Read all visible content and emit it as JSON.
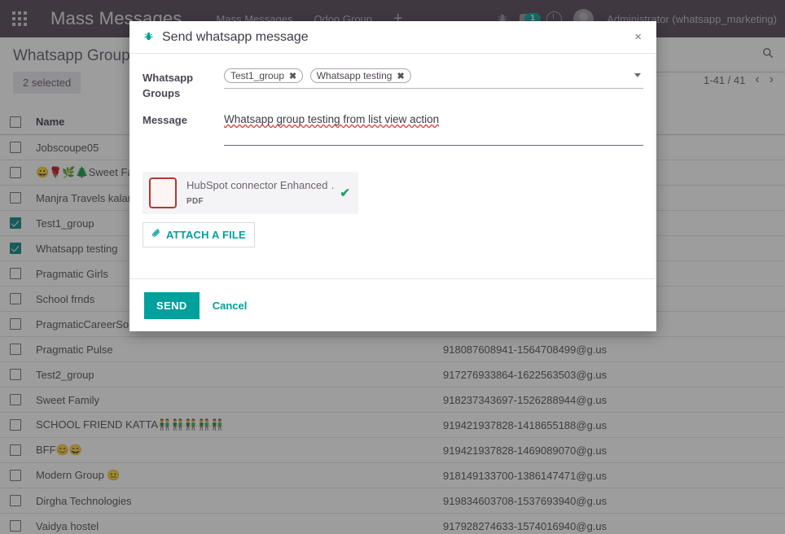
{
  "navbar": {
    "apps_icon": "apps-grid-icon",
    "brand": "Mass Messages",
    "menu": [
      {
        "label": "Mass Messages"
      },
      {
        "label": "Odoo Group"
      }
    ],
    "plus_label": "+",
    "debug_icon": "bug-icon",
    "messages_icon": "messages-icon",
    "messages_badge": "1",
    "activity_icon": "clock-icon",
    "avatar_icon": "user-avatar-icon",
    "user": "Administrator (whatsapp_marketing)"
  },
  "control_panel": {
    "title": "Whatsapp Group",
    "search_placeholder": "",
    "search_icon": "search-icon",
    "selected_badge": "2 selected",
    "pager": "1-41 / 41",
    "prev_icon": "‹",
    "next_icon": "›"
  },
  "list": {
    "columns": [
      "Name",
      ""
    ],
    "rows": [
      {
        "name": "Jobscoupe05",
        "number": "",
        "selected": false
      },
      {
        "name": "😀🌹🌿🌲Sweet Fa",
        "number": "",
        "selected": false
      },
      {
        "name": "Manjra Travels kalam",
        "number": "",
        "selected": false
      },
      {
        "name": "Test1_group",
        "number": "",
        "selected": true
      },
      {
        "name": "Whatsapp testing",
        "number": "",
        "selected": true
      },
      {
        "name": "Pragmatic Girls",
        "number": "",
        "selected": false
      },
      {
        "name": "School frnds",
        "number": "",
        "selected": false
      },
      {
        "name": "PragmaticCareerSol",
        "number": "",
        "selected": false
      },
      {
        "name": "Pragmatic Pulse",
        "number": "918087608941-1564708499@g.us",
        "selected": false
      },
      {
        "name": "Test2_group",
        "number": "917276933864-1622563503@g.us",
        "selected": false
      },
      {
        "name": "Sweet Family",
        "number": "918237343697-1526288944@g.us",
        "selected": false
      },
      {
        "name": "SCHOOL FRIEND KATTA👬👬👬👬👬",
        "number": "919421937828-1418655188@g.us",
        "selected": false
      },
      {
        "name": "BFF😊😄",
        "number": "919421937828-1469089070@g.us",
        "selected": false
      },
      {
        "name": "Modern Group 😐",
        "number": "918149133700-1386147471@g.us",
        "selected": false
      },
      {
        "name": "Dirgha Technologies",
        "number": "919834603708-1537693940@g.us",
        "selected": false
      },
      {
        "name": "Vaidya hostel",
        "number": "917928274633-1574016940@g.us",
        "selected": false
      }
    ]
  },
  "dialog": {
    "icon": "bug-icon",
    "title": "Send whatsapp message",
    "close_label": "×",
    "fields": {
      "groups_label": "Whatsapp Groups",
      "groups_tags": [
        "Test1_group",
        "Whatsapp testing"
      ],
      "tag_remove_label": "✖",
      "caret_icon": "chevron-down-icon",
      "message_label": "Message",
      "message_value_misspelled": "Whatsapp",
      "message_value_rest": " group testing from list view action"
    },
    "attachment": {
      "icon": "pdf-file-icon",
      "icon_glyph": "ᴀ",
      "name": "HubSpot connector Enhanced …",
      "type": "PDF",
      "check_icon": "check-icon",
      "check_glyph": "✔"
    },
    "attach_button": {
      "icon": "paperclip-icon",
      "icon_glyph": "✎",
      "label": "ATTACH A FILE"
    },
    "footer": {
      "send_label": "SEND",
      "cancel_label": "Cancel"
    }
  },
  "colors": {
    "accent": "#00a09d",
    "navbar": "#4b3f50",
    "check": "#00807c",
    "pdf": "#b03a33"
  }
}
